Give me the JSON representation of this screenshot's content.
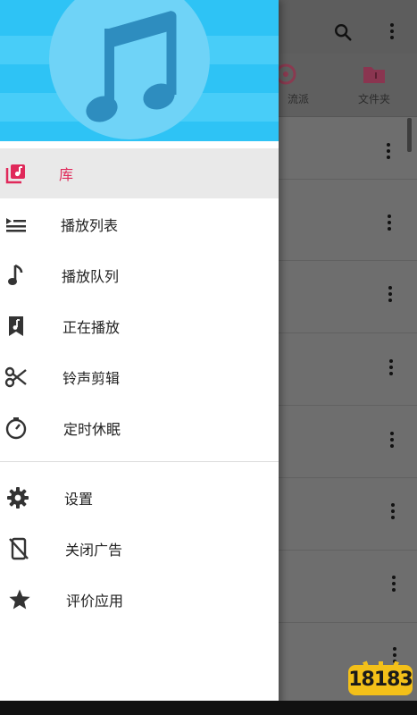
{
  "background_app": {
    "tabs": [
      {
        "label": "流派",
        "icon": "genre-disc-icon"
      },
      {
        "label": "文件夹",
        "icon": "folder-icon"
      }
    ],
    "toolbar_icons": [
      "search-icon",
      "more-vert-icon"
    ]
  },
  "drawer": {
    "header_icon": "music-note-icon",
    "items": [
      {
        "label": "库",
        "icon": "library-music-icon",
        "active": true
      },
      {
        "label": "播放列表",
        "icon": "playlist-icon"
      },
      {
        "label": "播放队列",
        "icon": "music-note-small-icon"
      },
      {
        "label": "正在播放",
        "icon": "now-playing-icon"
      },
      {
        "label": "铃声剪辑",
        "icon": "scissors-icon"
      },
      {
        "label": "定时休眠",
        "icon": "timer-icon"
      },
      {
        "label": "设置",
        "icon": "gear-icon"
      },
      {
        "label": "关闭广告",
        "icon": "no-ads-phone-icon"
      },
      {
        "label": "评价应用",
        "icon": "star-icon"
      }
    ]
  },
  "watermark": {
    "text": "18183"
  },
  "colors": {
    "accent": "#e0295a",
    "header": "#2ec3f5",
    "folder": "#c0446a"
  }
}
